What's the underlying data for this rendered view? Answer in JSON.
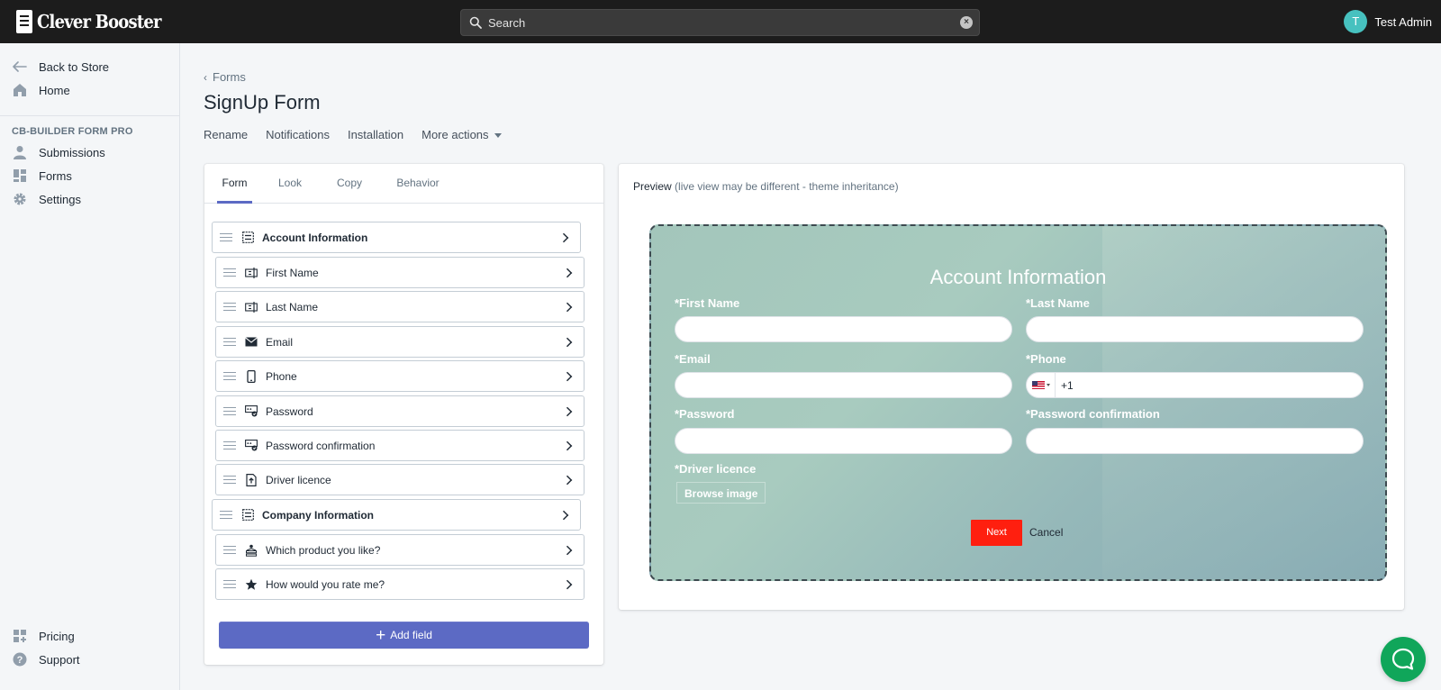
{
  "topbar": {
    "logo_text": "Clever Booster",
    "search_placeholder": "Search",
    "user_initial": "T",
    "user_name": "Test Admin"
  },
  "sidebar": {
    "back": "Back to Store",
    "home": "Home",
    "section": "CB-BUILDER FORM PRO",
    "items": [
      "Submissions",
      "Forms",
      "Settings"
    ],
    "bottom": [
      "Pricing",
      "Support"
    ]
  },
  "page": {
    "breadcrumb": "Forms",
    "title": "SignUp Form",
    "actions": [
      "Rename",
      "Notifications",
      "Installation",
      "More actions"
    ]
  },
  "tabs": [
    "Form",
    "Look",
    "Copy",
    "Behavior"
  ],
  "fields": [
    {
      "label": "Account Information",
      "icon": "section-icon",
      "group": true
    },
    {
      "label": "First Name",
      "icon": "text-field-icon",
      "group": false
    },
    {
      "label": "Last Name",
      "icon": "text-field-icon",
      "group": false
    },
    {
      "label": "Email",
      "icon": "envelope-icon",
      "group": false
    },
    {
      "label": "Phone",
      "icon": "mobile-phone-icon",
      "group": false
    },
    {
      "label": "Password",
      "icon": "password-icon",
      "group": false
    },
    {
      "label": "Password confirmation",
      "icon": "password-icon",
      "group": false
    },
    {
      "label": "Driver licence",
      "icon": "file-upload-icon",
      "group": false
    },
    {
      "label": "Company Information",
      "icon": "section-icon",
      "group": true
    },
    {
      "label": "Which product you like?",
      "icon": "choice-icon",
      "group": false
    },
    {
      "label": "How would you rate me?",
      "icon": "star-icon",
      "group": false
    }
  ],
  "add_field": "Add field",
  "preview": {
    "label": "Preview",
    "note": "(live view may be different - theme inheritance)",
    "title": "Account Information",
    "first_name": "*First Name",
    "last_name": "*Last Name",
    "email": "*Email",
    "phone": "*Phone",
    "phone_code": "+1",
    "password": "*Password",
    "password_confirmation": "*Password confirmation",
    "driver_licence": "*Driver licence",
    "browse": "Browse image",
    "next": "Next",
    "cancel": "Cancel"
  },
  "colors": {
    "accent": "#5c6ac4",
    "topbar": "#1c1c1c",
    "next_button": "#ff1f0f",
    "chat": "#10a65a",
    "avatar": "#47c1bf"
  }
}
